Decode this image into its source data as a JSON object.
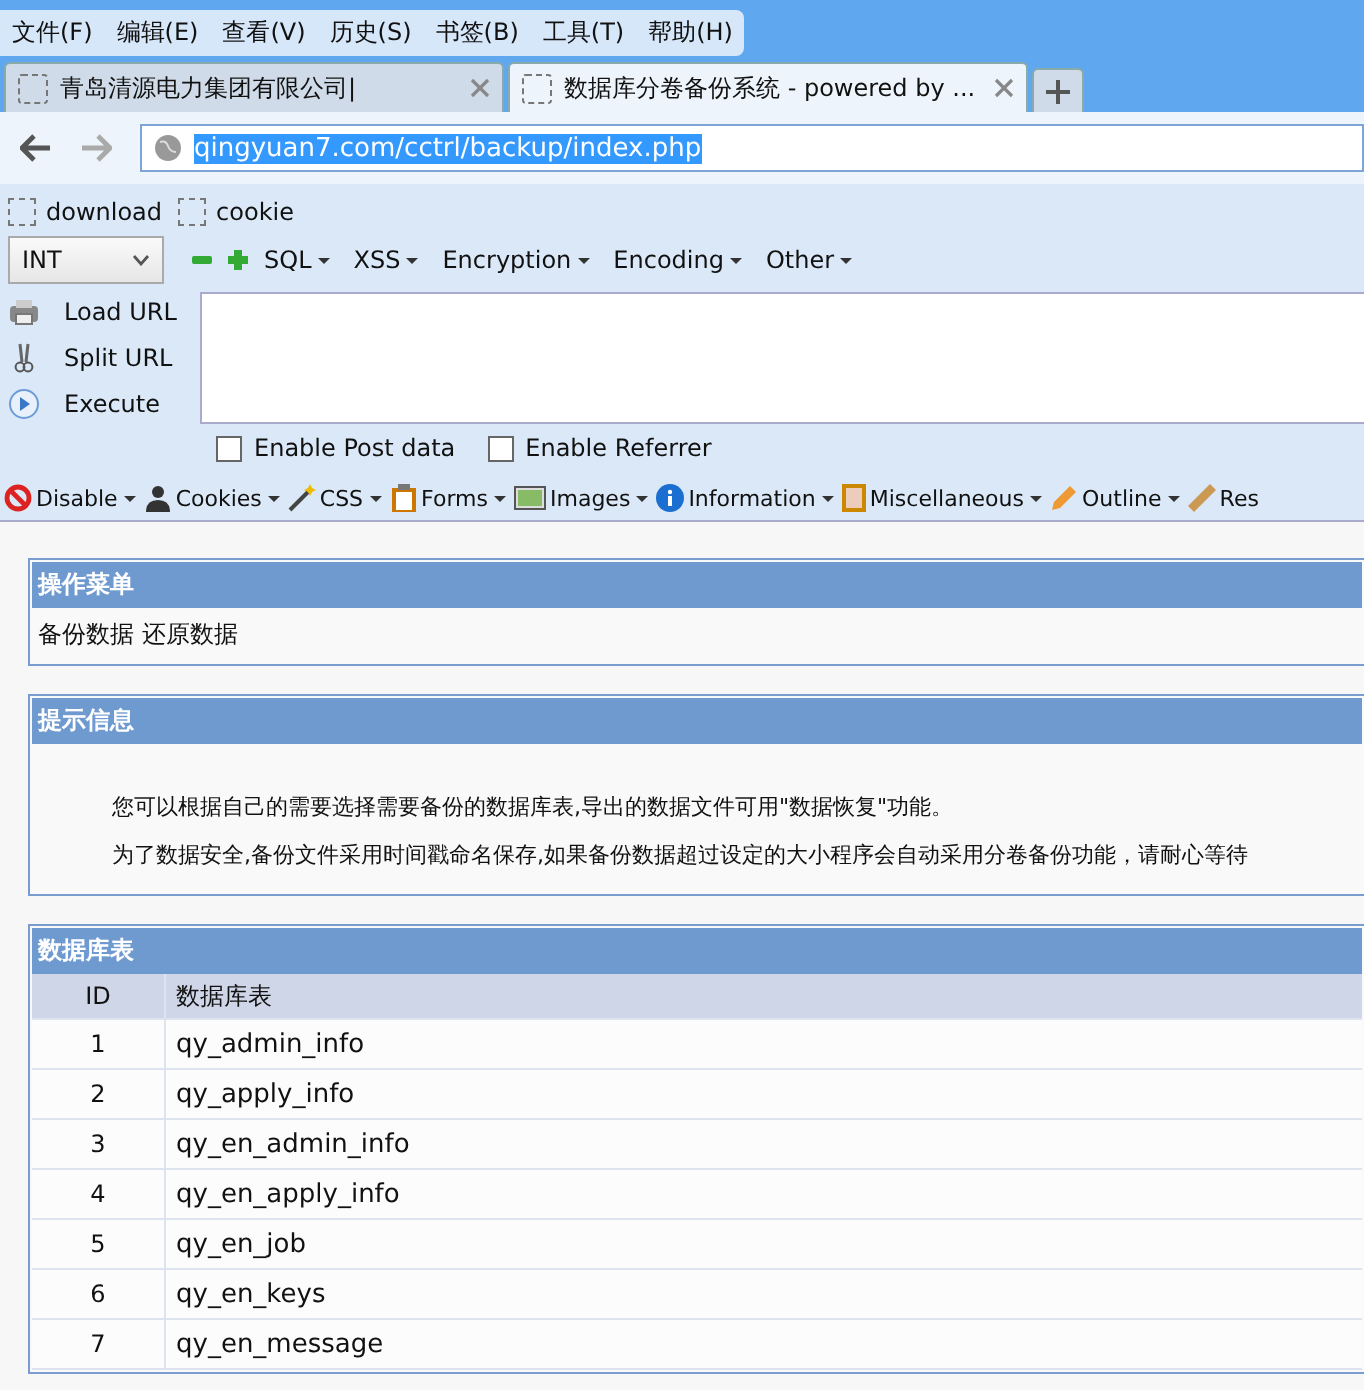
{
  "menu_bar": [
    "文件(F)",
    "编辑(E)",
    "查看(V)",
    "历史(S)",
    "书签(B)",
    "工具(T)",
    "帮助(H)"
  ],
  "tabs": [
    {
      "title": "青岛清源电力集团有限公司|",
      "selected": false
    },
    {
      "title": "数据库分卷备份系统 - powered by ...",
      "selected": true
    }
  ],
  "address_bar": {
    "url": "qingyuan7.com/cctrl/backup/index.php"
  },
  "hackbar": {
    "toggles": [
      {
        "label": "download",
        "checked": false
      },
      {
        "label": "cookie",
        "checked": false
      }
    ],
    "type_select": "INT",
    "menus": [
      "SQL",
      "XSS",
      "Encryption",
      "Encoding",
      "Other"
    ],
    "actions": [
      {
        "label": "Load URL",
        "kind": "load"
      },
      {
        "label": "Split URL",
        "kind": "split"
      },
      {
        "label": "Execute",
        "kind": "execute"
      }
    ],
    "options": [
      {
        "label": "Enable Post data",
        "checked": false
      },
      {
        "label": "Enable Referrer",
        "checked": false
      }
    ]
  },
  "webdev_toolbar": [
    {
      "label": "Disable",
      "kind": "disable"
    },
    {
      "label": "Cookies",
      "kind": "cookies"
    },
    {
      "label": "CSS",
      "kind": "css"
    },
    {
      "label": "Forms",
      "kind": "forms"
    },
    {
      "label": "Images",
      "kind": "images"
    },
    {
      "label": "Information",
      "kind": "info"
    },
    {
      "label": "Miscellaneous",
      "kind": "misc"
    },
    {
      "label": "Outline",
      "kind": "outline"
    },
    {
      "label": "Res",
      "kind": "resize"
    }
  ],
  "panels": {
    "menu": {
      "title": "操作菜单",
      "links": [
        "备份数据",
        "还原数据"
      ]
    },
    "info": {
      "title": "提示信息",
      "lines": [
        "您可以根据自己的需要选择需要备份的数据库表,导出的数据文件可用\"数据恢复\"功能。",
        "为了数据安全,备份文件采用时间戳命名保存,如果备份数据超过设定的大小程序会自动采用分卷备份功能，请耐心等待"
      ]
    },
    "tables": {
      "title": "数据库表",
      "columns": [
        "ID",
        "数据库表"
      ],
      "rows": [
        [
          "1",
          "qy_admin_info"
        ],
        [
          "2",
          "qy_apply_info"
        ],
        [
          "3",
          "qy_en_admin_info"
        ],
        [
          "4",
          "qy_en_apply_info"
        ],
        [
          "5",
          "qy_en_job"
        ],
        [
          "6",
          "qy_en_keys"
        ],
        [
          "7",
          "qy_en_message"
        ]
      ]
    }
  }
}
